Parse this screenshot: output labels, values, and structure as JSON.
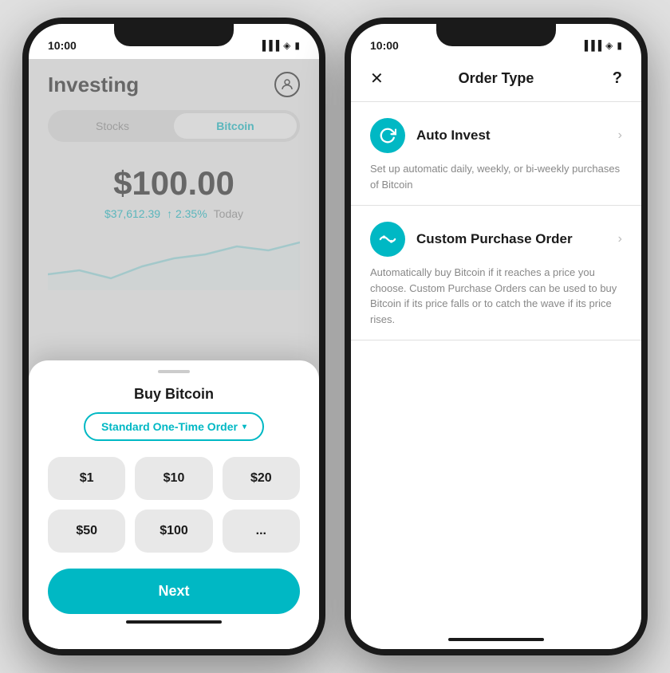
{
  "leftPhone": {
    "statusBar": {
      "time": "10:00",
      "icons": "▐▐ ◀ ▮"
    },
    "header": {
      "title": "Investing",
      "profileIcon": "👤"
    },
    "tabs": [
      {
        "label": "Stocks",
        "active": false
      },
      {
        "label": "Bitcoin",
        "active": true
      }
    ],
    "price": {
      "main": "$100.00",
      "btcPrice": "$37,612.39",
      "change": "↑ 2.35%",
      "period": "Today"
    },
    "bottomSheet": {
      "title": "Buy Bitcoin",
      "orderTypeLabel": "Standard One-Time Order",
      "amounts": [
        "$1",
        "$10",
        "$20",
        "$50",
        "$100",
        "..."
      ],
      "nextButton": "Next"
    }
  },
  "rightPhone": {
    "statusBar": {
      "time": "10:00"
    },
    "header": {
      "closeLabel": "✕",
      "title": "Order Type",
      "helpLabel": "?"
    },
    "options": [
      {
        "id": "auto-invest",
        "iconSymbol": "↺",
        "name": "Auto Invest",
        "description": "Set up automatic daily, weekly, or bi-weekly purchases of Bitcoin"
      },
      {
        "id": "custom-purchase",
        "iconSymbol": "〜",
        "name": "Custom Purchase Order",
        "description": "Automatically buy Bitcoin if it reaches a price you choose. Custom Purchase Orders can be used to buy Bitcoin if its price falls or to catch the wave if its price rises."
      }
    ]
  }
}
